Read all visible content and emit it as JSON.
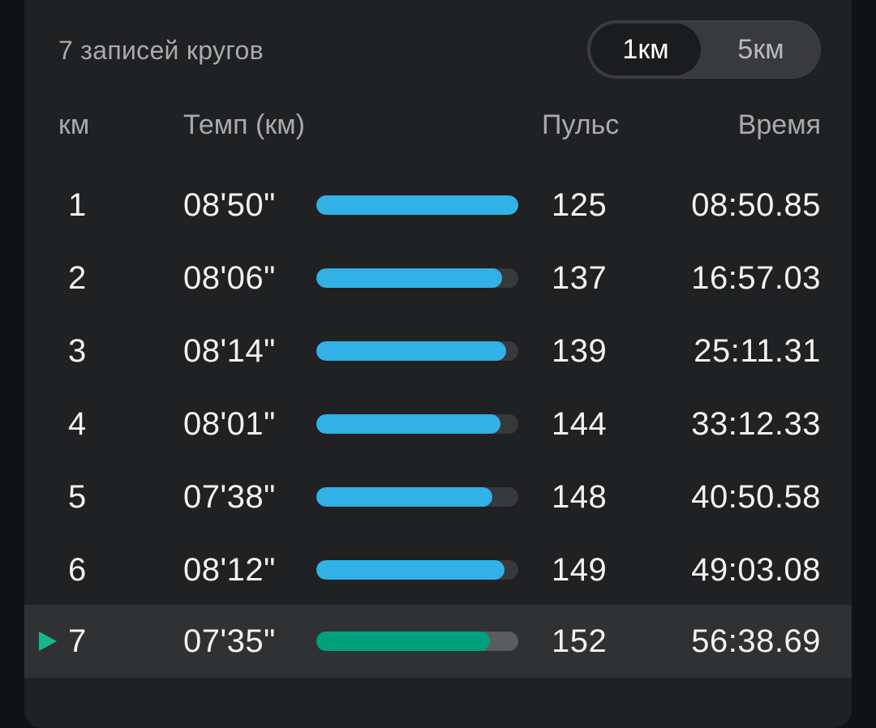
{
  "header": {
    "summary": "7 записей кругов",
    "toggle": {
      "option_1": "1км",
      "option_2": "5км",
      "selected": "1км"
    }
  },
  "columns": {
    "km": "км",
    "pace": "Темп (км)",
    "hr": "Пульс",
    "time": "Время"
  },
  "laps": [
    {
      "km": "1",
      "pace": "08'50\"",
      "hr": "125",
      "time": "08:50.85",
      "bar_fraction": 1.0
    },
    {
      "km": "2",
      "pace": "08'06\"",
      "hr": "137",
      "time": "16:57.03",
      "bar_fraction": 0.92
    },
    {
      "km": "3",
      "pace": "08'14\"",
      "hr": "139",
      "time": "25:11.31",
      "bar_fraction": 0.94
    },
    {
      "km": "4",
      "pace": "08'01\"",
      "hr": "144",
      "time": "33:12.33",
      "bar_fraction": 0.91
    },
    {
      "km": "5",
      "pace": "07'38\"",
      "hr": "148",
      "time": "40:50.58",
      "bar_fraction": 0.87
    },
    {
      "km": "6",
      "pace": "08'12\"",
      "hr": "149",
      "time": "49:03.08",
      "bar_fraction": 0.93
    },
    {
      "km": "7",
      "pace": "07'35\"",
      "hr": "152",
      "time": "56:38.69",
      "bar_fraction": 0.86,
      "current": true
    }
  ],
  "colors": {
    "bar": "#31b1e6",
    "bar_current": "#00a07d",
    "marker": "#17b890"
  },
  "icons": {
    "current_lap_marker": "play-icon"
  }
}
